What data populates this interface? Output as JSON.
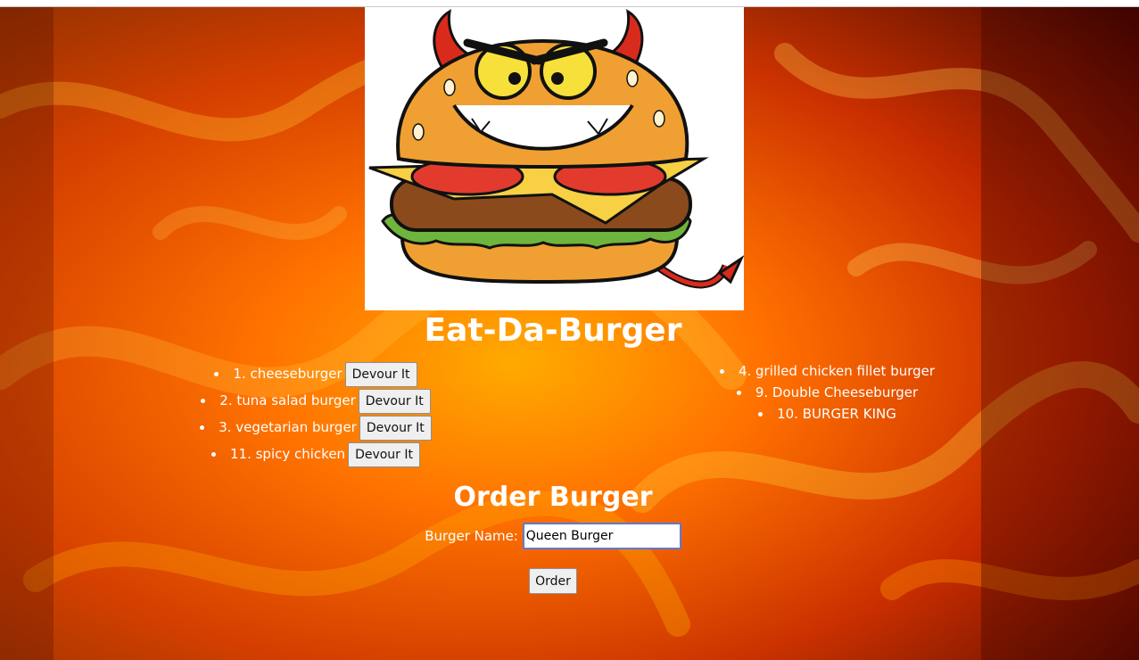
{
  "page": {
    "title": "Eat-Da-Burger",
    "background_colors": [
      "#5a0800",
      "#b52200",
      "#ff6a00",
      "#ffb000"
    ]
  },
  "logo": {
    "icon": "devil-burger-icon"
  },
  "uneaten": {
    "items": [
      {
        "label": "1. cheeseburger",
        "button": "Devour It"
      },
      {
        "label": "2. tuna salad burger",
        "button": "Devour It"
      },
      {
        "label": "3. vegetarian burger",
        "button": "Devour It"
      },
      {
        "label": "11. spicy chicken",
        "button": "Devour It"
      }
    ]
  },
  "devoured": {
    "items": [
      {
        "label": "4. grilled chicken fillet burger"
      },
      {
        "label": "9. Double Cheeseburger"
      },
      {
        "label": "10. BURGER KING"
      }
    ]
  },
  "order_form": {
    "heading": "Order Burger",
    "label": "Burger Name:",
    "value": "Queen Burger",
    "button": "Order"
  }
}
